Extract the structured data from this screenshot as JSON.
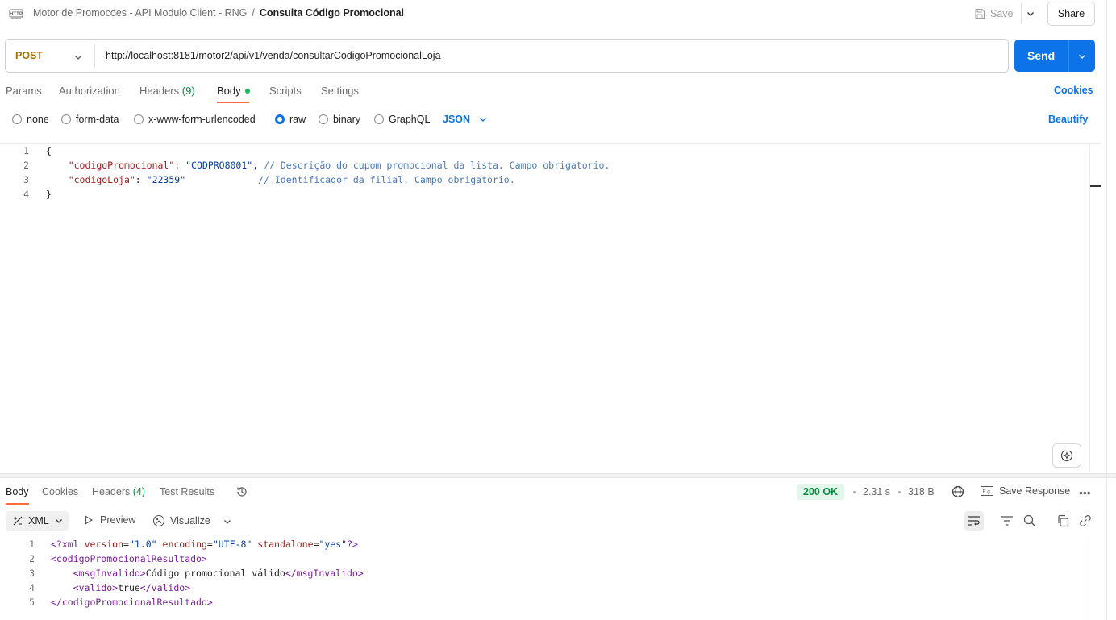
{
  "topbar": {
    "breadcrumb_parent": "Motor de Promocoes - API Modulo Client - RNG",
    "breadcrumb_separator": "/",
    "breadcrumb_current": "Consulta Código Promocional",
    "save_label": "Save",
    "share_label": "Share"
  },
  "request": {
    "method": "POST",
    "url": "http://localhost:8181/motor2/api/v1/venda/consultarCodigoPromocionalLoja",
    "send_label": "Send"
  },
  "request_tabs": {
    "params": "Params",
    "authorization": "Authorization",
    "headers": "Headers",
    "headers_count": "(9)",
    "body": "Body",
    "scripts": "Scripts",
    "settings": "Settings",
    "cookies": "Cookies",
    "active": "Body"
  },
  "body_types": {
    "none": "none",
    "form_data": "form-data",
    "urlencoded": "x-www-form-urlencoded",
    "raw": "raw",
    "binary": "binary",
    "graphql": "GraphQL",
    "selected": "raw",
    "language": "JSON",
    "beautify": "Beautify"
  },
  "request_body": {
    "line_numbers": [
      "1",
      "2",
      "3",
      "4"
    ],
    "open_brace": "{",
    "close_brace": "}",
    "key1": "\"codigoPromocional\"",
    "val1": "\"CODPRO8001\"",
    "comment1": "// Descrição do cupom promocional da lista. Campo obrigatorio.",
    "key2": "\"codigoLoja\"",
    "val2": "\"22359\"",
    "comment2": "// Identificador da filial. Campo obrigatorio."
  },
  "response_tabs": {
    "body": "Body",
    "cookies": "Cookies",
    "headers": "Headers",
    "headers_count": "(4)",
    "test_results": "Test Results",
    "active": "Body"
  },
  "response_meta": {
    "status": "200 OK",
    "time": "2.31 s",
    "size": "318 B",
    "save_response": "Save Response",
    "status_color": "#078a3f"
  },
  "response_toolbar": {
    "format": "XML",
    "preview": "Preview",
    "visualize": "Visualize"
  },
  "response_body": {
    "line_numbers": [
      "1",
      "2",
      "3",
      "4",
      "5"
    ],
    "decl_open": "<?xml",
    "attr_version": "version",
    "val_version": "\"1.0\"",
    "attr_encoding": "encoding",
    "val_encoding": "\"UTF-8\"",
    "attr_standalone": "standalone",
    "val_standalone": "\"yes\"",
    "decl_close": "?>",
    "root_open": "<codigoPromocionalResultado>",
    "msg_open": "<msgInvalido>",
    "msg_text": "Código promocional válido",
    "msg_close": "</msgInvalido>",
    "valido_open": "<valido>",
    "valido_text": "true",
    "valido_close": "</valido>",
    "root_close": "</codigoPromocionalResultado>"
  },
  "colors": {
    "accent_blue": "#0c73e8",
    "tab_underline": "#ff6c37",
    "method_post": "#a86d00",
    "status_green": "#078a3f"
  }
}
